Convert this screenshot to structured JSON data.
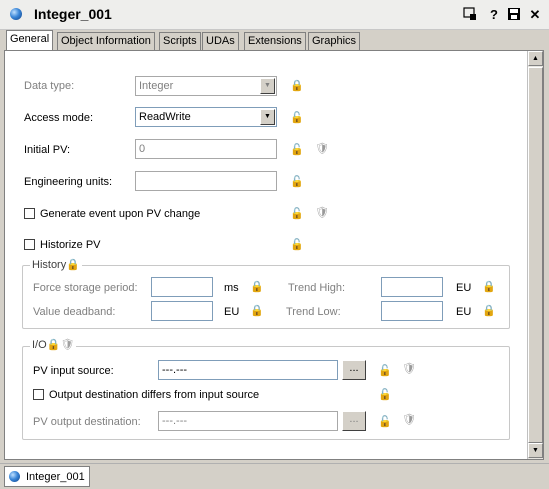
{
  "window": {
    "title": "Integer_001",
    "toolbar_icons": [
      "lock-icon",
      "help-icon",
      "save-icon",
      "close-icon"
    ],
    "help_glyph": "?",
    "close_glyph": "✕"
  },
  "tabs": [
    {
      "label": "General",
      "active": true
    },
    {
      "label": "Object Information"
    },
    {
      "label": "Scripts"
    },
    {
      "label": "UDAs"
    },
    {
      "label": "Extensions"
    },
    {
      "label": "Graphics"
    }
  ],
  "general": {
    "data_type": {
      "label": "Data type:",
      "value": "Integer"
    },
    "access_mode": {
      "label": "Access mode:",
      "value": "ReadWrite"
    },
    "initial_pv": {
      "label": "Initial PV:",
      "value": "0"
    },
    "engineering_units": {
      "label": "Engineering units:",
      "value": ""
    },
    "generate_event": {
      "label": "Generate event upon PV change",
      "checked": false
    },
    "historize_pv": {
      "label": "Historize PV",
      "checked": false
    }
  },
  "history": {
    "title": "History",
    "force_storage_period": {
      "label": "Force storage period:",
      "value": "",
      "unit": "ms"
    },
    "value_deadband": {
      "label": "Value deadband:",
      "value": "",
      "unit": "EU"
    },
    "trend_high": {
      "label": "Trend High:",
      "value": "",
      "unit": "EU"
    },
    "trend_low": {
      "label": "Trend Low:",
      "value": "",
      "unit": "EU"
    }
  },
  "io": {
    "title": "I/O",
    "pv_input_source": {
      "label": "PV input source:",
      "value": "---.---",
      "browse": "..."
    },
    "output_differs": {
      "label": "Output destination differs from input source",
      "checked": false
    },
    "pv_output_destination": {
      "label": "PV output destination:",
      "value": "---.---",
      "browse": "..."
    }
  },
  "bottom_tab": {
    "label": "Integer_001"
  },
  "colors": {
    "orb": "#3a86d8",
    "panel": "#ffffff",
    "chrome": "#d4d0c8"
  }
}
